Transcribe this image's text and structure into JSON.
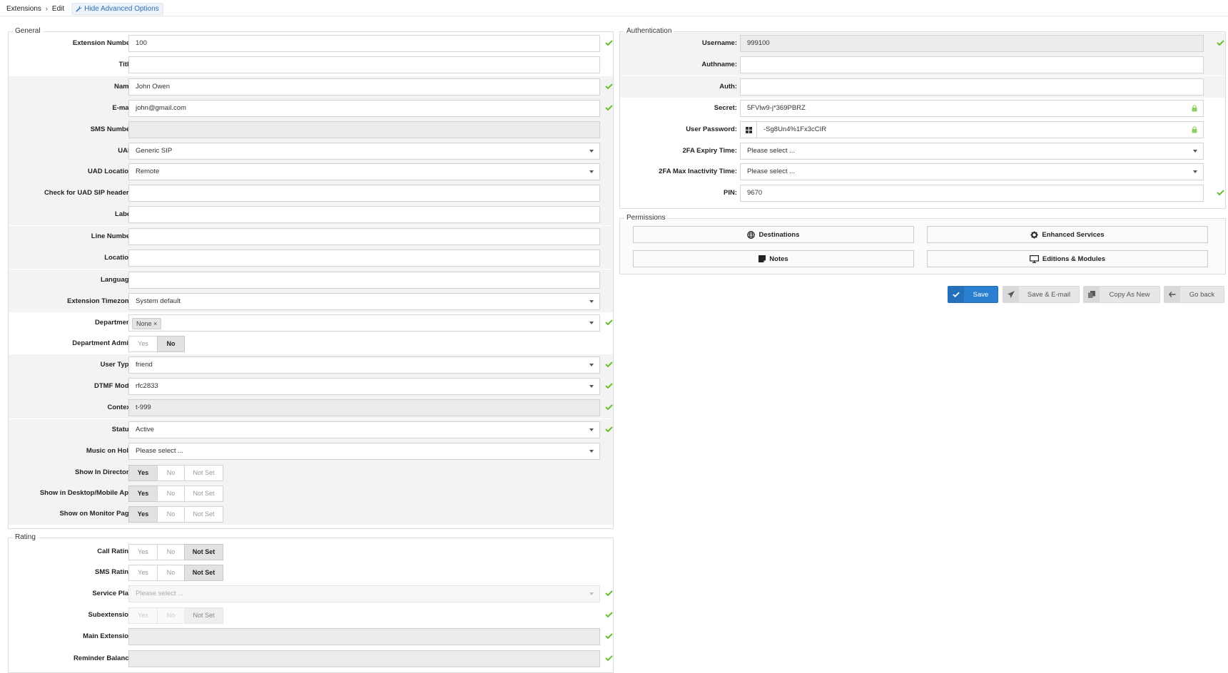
{
  "breadcrumb": {
    "root": "Extensions",
    "current": "Edit",
    "advanced_button": "Hide Advanced Options"
  },
  "general": {
    "legend": "General",
    "extension_number": {
      "label": "Extension Number:",
      "value": "100"
    },
    "title": {
      "label": "Title:",
      "value": ""
    },
    "name": {
      "label": "Name:",
      "value": "John Owen"
    },
    "email": {
      "label": "E-mail:",
      "value": "john@gmail.com"
    },
    "sms_number": {
      "label": "SMS Number:",
      "value": ""
    },
    "uad": {
      "label": "UAD:",
      "value": "Generic SIP"
    },
    "uad_location": {
      "label": "UAD Location:",
      "value": "Remote"
    },
    "check_uad_sip": {
      "label": "Check for UAD SIP headers:",
      "value": ""
    },
    "label_field": {
      "label": "Label:",
      "value": ""
    },
    "line_number": {
      "label": "Line Number:",
      "value": ""
    },
    "location": {
      "label": "Location:",
      "value": ""
    },
    "language": {
      "label": "Language:",
      "value": ""
    },
    "timezone": {
      "label": "Extension Timezone:",
      "value": "System default"
    },
    "department": {
      "label": "Department:",
      "tag": "None ×"
    },
    "department_admin": {
      "label": "Department Admin:",
      "options": [
        "Yes",
        "No"
      ],
      "selected": "No"
    },
    "user_type": {
      "label": "User Type:",
      "value": "friend"
    },
    "dtmf_mode": {
      "label": "DTMF Mode:",
      "value": "rfc2833"
    },
    "context": {
      "label": "Context:",
      "value": "t-999"
    },
    "status": {
      "label": "Status:",
      "value": "Active"
    },
    "music_on_hold": {
      "label": "Music on Hold:",
      "value": "Please select ..."
    },
    "show_in_directory": {
      "label": "Show In Directory:",
      "options": [
        "Yes",
        "No",
        "Not Set"
      ],
      "selected": "Yes"
    },
    "show_in_app": {
      "label": "Show in Desktop/Mobile App:",
      "options": [
        "Yes",
        "No",
        "Not Set"
      ],
      "selected": "Yes"
    },
    "show_on_monitor": {
      "label": "Show on Monitor Page:",
      "options": [
        "Yes",
        "No",
        "Not Set"
      ],
      "selected": "Yes"
    }
  },
  "rating": {
    "legend": "Rating",
    "call_rating": {
      "label": "Call Rating:",
      "options": [
        "Yes",
        "No",
        "Not Set"
      ],
      "selected": "Not Set"
    },
    "sms_rating": {
      "label": "SMS Rating:",
      "options": [
        "Yes",
        "No",
        "Not Set"
      ],
      "selected": "Not Set"
    },
    "service_plan": {
      "label": "Service Plan:",
      "value": "Please select ..."
    },
    "subextension": {
      "label": "Subextension:",
      "options": [
        "Yes",
        "No",
        "Not Set"
      ],
      "selected": "Not Set"
    },
    "main_extension": {
      "label": "Main Extension:",
      "value": ""
    },
    "reminder_balance": {
      "label": "Reminder Balance:",
      "value": ""
    }
  },
  "auth": {
    "legend": "Authentication",
    "username": {
      "label": "Username:",
      "value": "999100"
    },
    "authname": {
      "label": "Authname:",
      "value": ""
    },
    "auth": {
      "label": "Auth:",
      "value": ""
    },
    "secret": {
      "label": "Secret:",
      "value": "5FVlw9-j*369PBRZ"
    },
    "user_password": {
      "label": "User Password:",
      "value": "-Sg8Un4%1Fx3cCIR"
    },
    "twofa_expiry": {
      "label": "2FA Expiry Time:",
      "value": "Please select ..."
    },
    "twofa_inactivity": {
      "label": "2FA Max Inactivity Time:",
      "value": "Please select ..."
    },
    "pin": {
      "label": "PIN:",
      "value": "9670"
    }
  },
  "permissions": {
    "legend": "Permissions",
    "destinations": "Destinations",
    "enhanced_services": "Enhanced Services",
    "notes": "Notes",
    "editions_modules": "Editions & Modules"
  },
  "actions": {
    "save": "Save",
    "save_email": "Save & E-mail",
    "copy_as_new": "Copy As New",
    "go_back": "Go back"
  },
  "colors": {
    "accent": "#2b7fd0",
    "check": "#6abf2a",
    "link": "#2a6fb8"
  }
}
